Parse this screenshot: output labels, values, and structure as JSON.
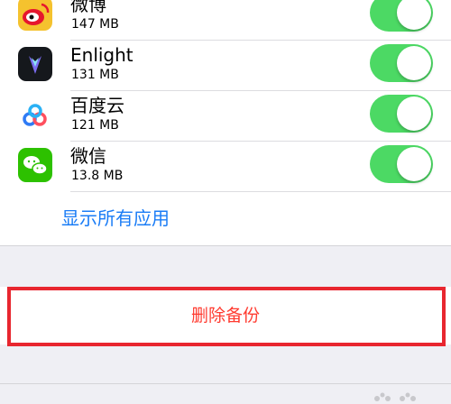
{
  "apps": [
    {
      "name": "微博",
      "size": "147 MB",
      "icon": "weibo-icon",
      "enabled": true
    },
    {
      "name": "Enlight",
      "size": "131 MB",
      "icon": "enlight-icon",
      "enabled": true
    },
    {
      "name": "百度云",
      "size": "121 MB",
      "icon": "baidu-cloud-icon",
      "enabled": true
    },
    {
      "name": "微信",
      "size": "13.8 MB",
      "icon": "wechat-icon",
      "enabled": true
    }
  ],
  "show_all_label": "显示所有应用",
  "delete_backup_label": "删除备份",
  "colors": {
    "toggle_on": "#4cd964",
    "link_blue": "#1a7cf6",
    "destructive_red": "#ff3b30",
    "highlight_box": "#e8262f"
  }
}
